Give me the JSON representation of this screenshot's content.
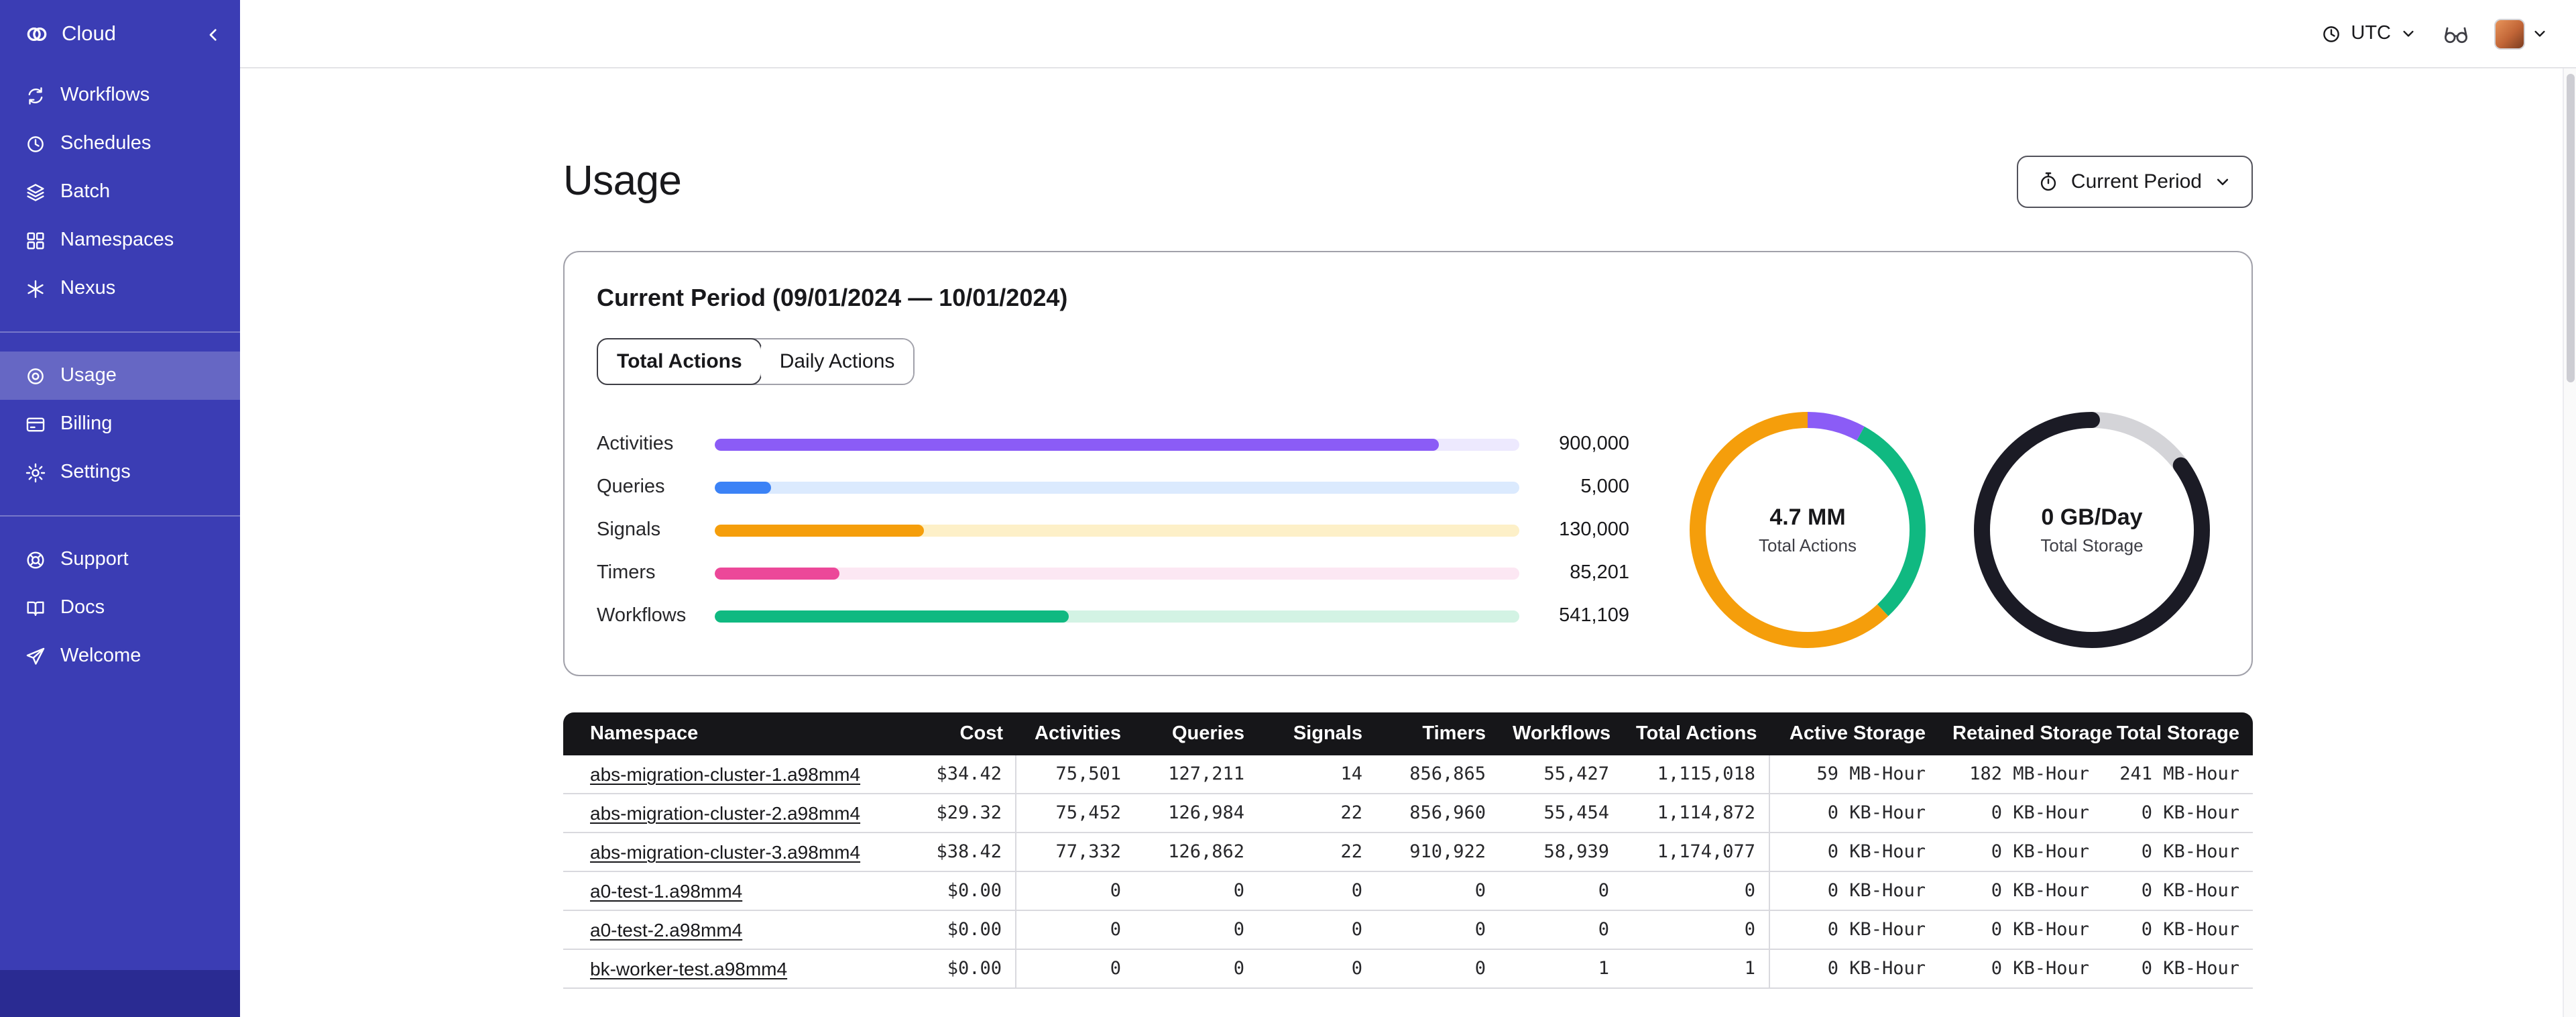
{
  "colors": {
    "sidebar_bg": "#3b3db4",
    "sidebar_active": "rgba(255,255,255,0.22)",
    "table_header_bg": "#161619",
    "card_border": "#a1a1aa"
  },
  "sidebar": {
    "brand_label": "Cloud",
    "nav_primary": [
      {
        "label": "Workflows",
        "icon": "workflows-icon"
      },
      {
        "label": "Schedules",
        "icon": "schedules-icon"
      },
      {
        "label": "Batch",
        "icon": "batch-icon"
      },
      {
        "label": "Namespaces",
        "icon": "namespaces-icon"
      },
      {
        "label": "Nexus",
        "icon": "nexus-icon"
      }
    ],
    "nav_account": [
      {
        "label": "Usage",
        "icon": "usage-icon",
        "active": true
      },
      {
        "label": "Billing",
        "icon": "billing-icon",
        "active": false
      },
      {
        "label": "Settings",
        "icon": "settings-icon",
        "active": false
      }
    ],
    "nav_footer": [
      {
        "label": "Support",
        "icon": "support-icon"
      },
      {
        "label": "Docs",
        "icon": "docs-icon"
      },
      {
        "label": "Welcome",
        "icon": "welcome-icon"
      }
    ]
  },
  "topbar": {
    "timezone_label": "UTC"
  },
  "page": {
    "title": "Usage",
    "period_selector_label": "Current Period"
  },
  "usage_card": {
    "title": "Current Period (09/01/2024 — 10/01/2024)",
    "tabs": [
      {
        "label": "Total Actions",
        "active": true
      },
      {
        "label": "Daily Actions",
        "active": false
      }
    ]
  },
  "chart_data": {
    "bars": {
      "type": "bar",
      "orientation": "horizontal",
      "series": [
        {
          "label": "Activities",
          "value": 900000,
          "value_label": "900,000",
          "pct": 90,
          "color": "#8b5cf6",
          "track_color": "#ede9fe"
        },
        {
          "label": "Queries",
          "value": 5000,
          "value_label": "5,000",
          "pct": 7,
          "color": "#3b82f6",
          "track_color": "#dbeafe"
        },
        {
          "label": "Signals",
          "value": 130000,
          "value_label": "130,000",
          "pct": 26,
          "color": "#f59e0b",
          "track_color": "#fdf0c8"
        },
        {
          "label": "Timers",
          "value": 85201,
          "value_label": "85,201",
          "pct": 15.5,
          "color": "#ec4899",
          "track_color": "#fce7f3"
        },
        {
          "label": "Workflows",
          "value": 541109,
          "value_label": "541,109",
          "pct": 44,
          "color": "#10b981",
          "track_color": "#d3f3e4"
        }
      ]
    },
    "donuts": [
      {
        "type": "pie",
        "value_label": "4.7 MM",
        "caption": "Total Actions",
        "segments": [
          {
            "color": "#8b5cf6",
            "pct": 8
          },
          {
            "color": "#10b981",
            "pct": 30
          },
          {
            "color": "#f59e0b",
            "pct": 62
          }
        ]
      },
      {
        "type": "pie",
        "value_label": "0 GB/Day",
        "caption": "Total Storage",
        "segments": [
          {
            "color": "#d4d4d8",
            "pct": 15
          },
          {
            "color": "#1b1b25",
            "pct": 85,
            "round": true
          }
        ]
      }
    ]
  },
  "table": {
    "columns": [
      "Namespace",
      "Cost",
      "Activities",
      "Queries",
      "Signals",
      "Timers",
      "Workflows",
      "Total Actions",
      "Active Storage",
      "Retained Storage",
      "Total Storage"
    ],
    "rows": [
      {
        "namespace": "abs-migration-cluster-1.a98mm4",
        "cost": "$34.42",
        "activities": "75,501",
        "queries": "127,211",
        "signals": "14",
        "timers": "856,865",
        "workflows": "55,427",
        "total_actions": "1,115,018",
        "active_storage": "59 MB-Hour",
        "retained_storage": "182 MB-Hour",
        "total_storage": "241 MB-Hour"
      },
      {
        "namespace": "abs-migration-cluster-2.a98mm4",
        "cost": "$29.32",
        "activities": "75,452",
        "queries": "126,984",
        "signals": "22",
        "timers": "856,960",
        "workflows": "55,454",
        "total_actions": "1,114,872",
        "active_storage": "0 KB-Hour",
        "retained_storage": "0 KB-Hour",
        "total_storage": "0 KB-Hour"
      },
      {
        "namespace": "abs-migration-cluster-3.a98mm4",
        "cost": "$38.42",
        "activities": "77,332",
        "queries": "126,862",
        "signals": "22",
        "timers": "910,922",
        "workflows": "58,939",
        "total_actions": "1,174,077",
        "active_storage": "0 KB-Hour",
        "retained_storage": "0 KB-Hour",
        "total_storage": "0 KB-Hour"
      },
      {
        "namespace": "a0-test-1.a98mm4",
        "cost": "$0.00",
        "activities": "0",
        "queries": "0",
        "signals": "0",
        "timers": "0",
        "workflows": "0",
        "total_actions": "0",
        "active_storage": "0 KB-Hour",
        "retained_storage": "0 KB-Hour",
        "total_storage": "0 KB-Hour"
      },
      {
        "namespace": "a0-test-2.a98mm4",
        "cost": "$0.00",
        "activities": "0",
        "queries": "0",
        "signals": "0",
        "timers": "0",
        "workflows": "0",
        "total_actions": "0",
        "active_storage": "0 KB-Hour",
        "retained_storage": "0 KB-Hour",
        "total_storage": "0 KB-Hour"
      },
      {
        "namespace": "bk-worker-test.a98mm4",
        "cost": "$0.00",
        "activities": "0",
        "queries": "0",
        "signals": "0",
        "timers": "0",
        "workflows": "1",
        "total_actions": "1",
        "active_storage": "0 KB-Hour",
        "retained_storage": "0 KB-Hour",
        "total_storage": "0 KB-Hour"
      }
    ]
  }
}
